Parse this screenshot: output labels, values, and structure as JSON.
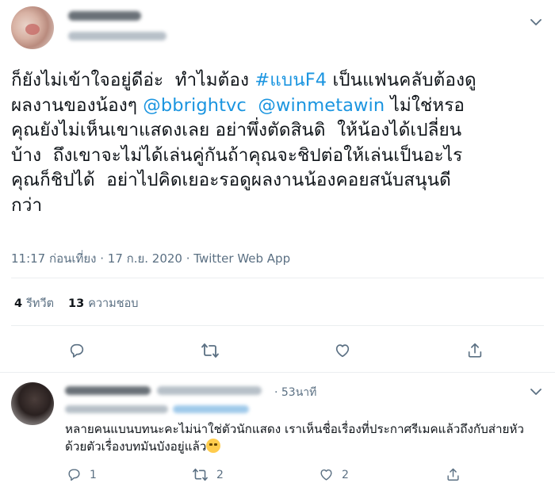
{
  "main_tweet": {
    "text_lines": [
      [
        {
          "t": "ก็ยังไม่เข้าใจอยู่ดีอ่ะ  ทำไมต้อง "
        },
        {
          "t": "#แบนF4",
          "link": true
        },
        {
          "t": " เป็นแฟนคลับต้องดู"
        }
      ],
      [
        {
          "t": "ผลงานของน้องๆ "
        },
        {
          "t": "@bbrightvc",
          "link": true
        },
        {
          "t": "  "
        },
        {
          "t": "@winmetawin",
          "link": true
        },
        {
          "t": " ไม่ใช่หรอ"
        }
      ],
      [
        {
          "t": "คุณยังไม่เห็นเขาแสดงเลย อย่าพึ่งตัดสินดิ  ให้น้องได้เปลี่ยน"
        }
      ],
      [
        {
          "t": "บ้าง  ถึงเขาจะไม่ได้เล่นคู่กันถ้าคุณจะชิปต่อให้เล่นเป็นอะไร"
        }
      ],
      [
        {
          "t": "คุณก็ชิปได้  อย่าไปคิดเยอะรอดูผลงานน้องคอยสนับสนุนดี"
        }
      ],
      [
        {
          "t": "กว่า"
        }
      ]
    ],
    "meta": "11:17 ก่อนเที่ยง · 17 ก.ย. 2020 · Twitter Web App",
    "retweets_count": "4",
    "retweets_label": "รีทวีต",
    "likes_count": "13",
    "likes_label": "ความชอบ"
  },
  "reply_tweet": {
    "time": "· 53นาที",
    "text": "หลายคนแบนบทนะคะไม่น่าใช่ตัวนักแสดง เราเห็นชื่อเรื่องที่ประกาศรีเมคแล้วถึงกับส่ายหัว ด้วยตัวเรื่องบทมันบังอยู่แล้ว",
    "reply_count": "1",
    "retweet_count": "2",
    "like_count": "2"
  },
  "colors": {
    "link": "#1b95e0",
    "secondary_text": "#5b7083",
    "icon": "#5b7083"
  },
  "icons": {
    "caret": "chevron-down-icon",
    "reply": "reply-icon",
    "retweet": "retweet-icon",
    "like": "heart-icon",
    "share": "share-icon",
    "emoji": "rolling-eyes-emoji-icon"
  }
}
